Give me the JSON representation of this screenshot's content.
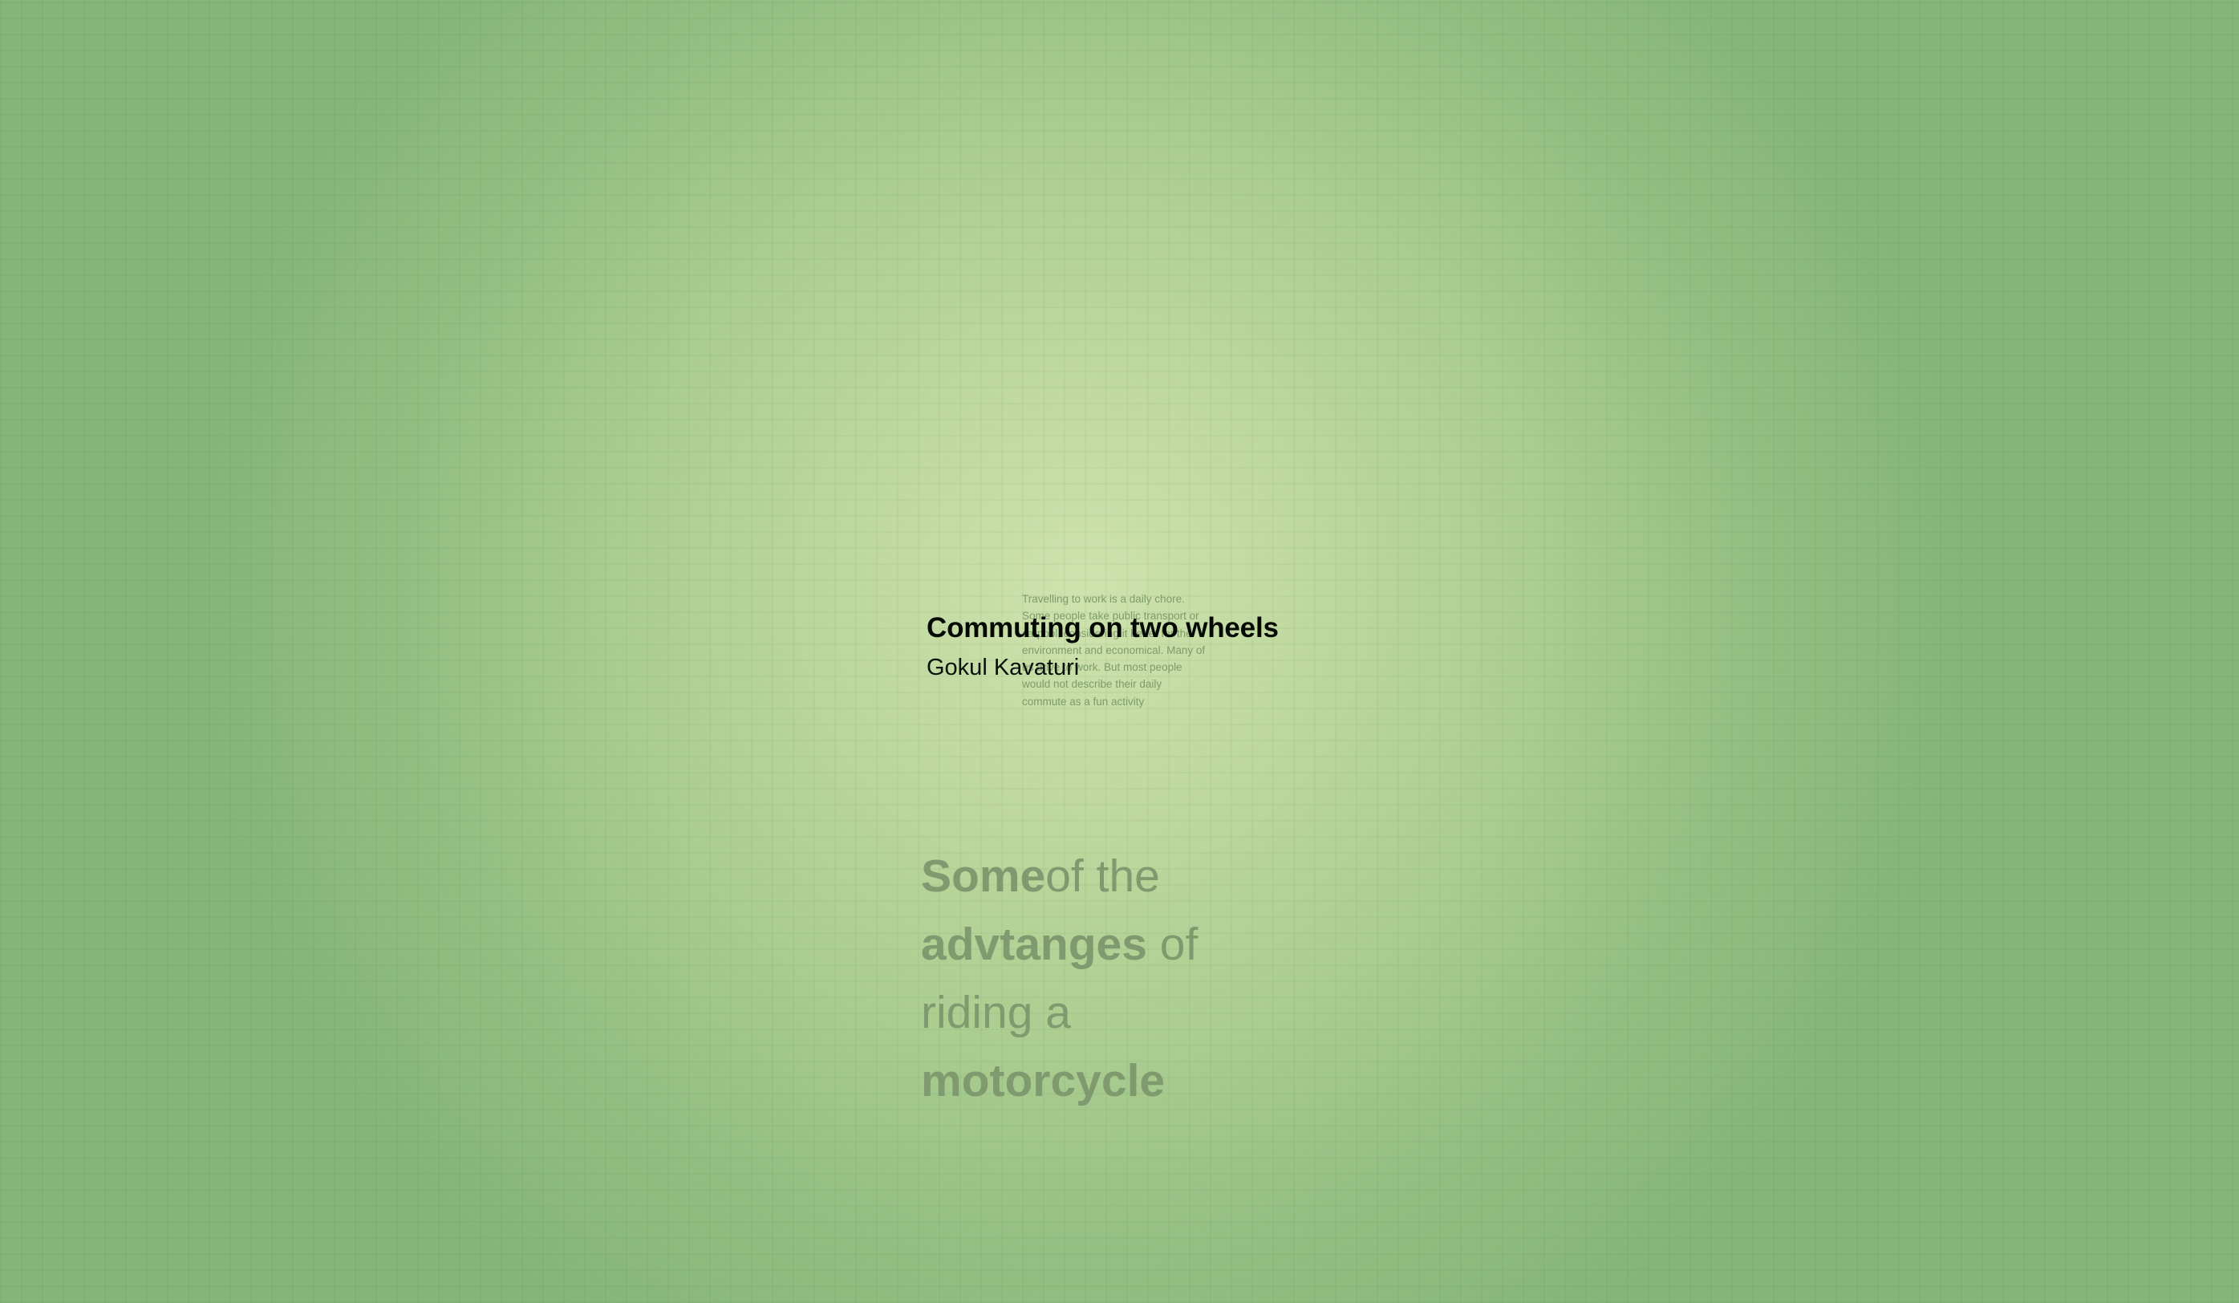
{
  "article": {
    "title": "Commuting on two wheels",
    "author": "Gokul Kavaturi",
    "intro_lines": [
      "Travelling to work is a daily chore.",
      "Some people take public transport or",
      "carpool, considering it better for the",
      "environment and economical. Many of",
      "us drive to work. But most people",
      "would not describe their daily",
      "commute as a fun activity"
    ]
  },
  "section_heading": {
    "line1_bold": "Some",
    "line1_rest": "of the",
    "line2_bold": "advtanges",
    "line2_rest": " of",
    "line3": "riding a",
    "line4_bold": "motorcycle"
  },
  "colors": {
    "background_center": "#cfe2ad",
    "background_edge": "#86b577",
    "title": "#050805",
    "muted_text": "#7e9a6e"
  }
}
